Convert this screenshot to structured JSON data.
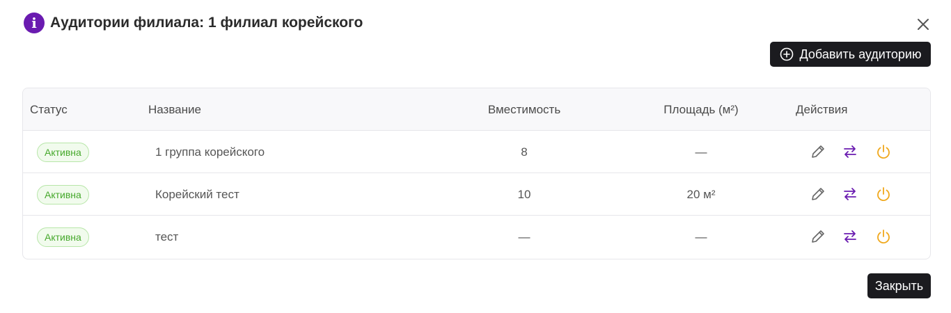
{
  "dialog": {
    "title": "Аудитории филиала: 1 филиал корейского",
    "info_icon": "i",
    "add_button_label": "Добавить аудиторию",
    "close_button_label": "Закрыть"
  },
  "table": {
    "headers": {
      "status": "Статус",
      "name": "Название",
      "capacity": "Вместимость",
      "area": "Площадь (м²)",
      "actions": "Действия"
    },
    "rows": [
      {
        "status": "Активна",
        "name": "1 группа корейского",
        "capacity": "8",
        "area": "—"
      },
      {
        "status": "Активна",
        "name": "Корейский тест",
        "capacity": "10",
        "area": "20 м²"
      },
      {
        "status": "Активна",
        "name": "тест",
        "capacity": "—",
        "area": "—"
      }
    ],
    "row_actions": [
      "edit-icon",
      "transfer-icon",
      "power-icon"
    ]
  },
  "colors": {
    "accent_purple": "#6a1bb0",
    "dark_button": "#1b1b1f",
    "status_green": "#45a82b",
    "power_orange": "#f0a81c"
  }
}
